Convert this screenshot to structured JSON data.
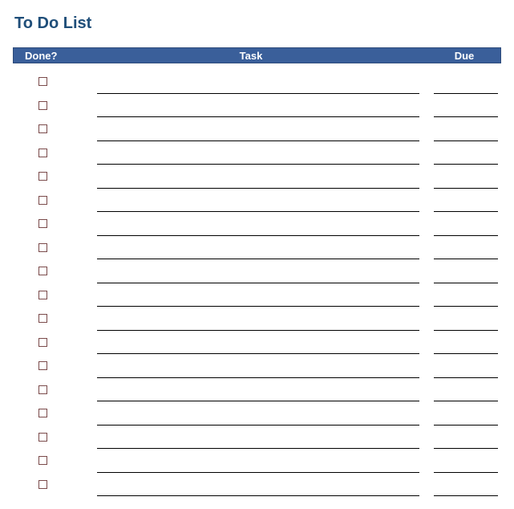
{
  "title": "To Do List",
  "columns": {
    "done": "Done?",
    "task": "Task",
    "due": "Due"
  },
  "rows": [
    {
      "done": false,
      "task": "",
      "due": ""
    },
    {
      "done": false,
      "task": "",
      "due": ""
    },
    {
      "done": false,
      "task": "",
      "due": ""
    },
    {
      "done": false,
      "task": "",
      "due": ""
    },
    {
      "done": false,
      "task": "",
      "due": ""
    },
    {
      "done": false,
      "task": "",
      "due": ""
    },
    {
      "done": false,
      "task": "",
      "due": ""
    },
    {
      "done": false,
      "task": "",
      "due": ""
    },
    {
      "done": false,
      "task": "",
      "due": ""
    },
    {
      "done": false,
      "task": "",
      "due": ""
    },
    {
      "done": false,
      "task": "",
      "due": ""
    },
    {
      "done": false,
      "task": "",
      "due": ""
    },
    {
      "done": false,
      "task": "",
      "due": ""
    },
    {
      "done": false,
      "task": "",
      "due": ""
    },
    {
      "done": false,
      "task": "",
      "due": ""
    },
    {
      "done": false,
      "task": "",
      "due": ""
    },
    {
      "done": false,
      "task": "",
      "due": ""
    },
    {
      "done": false,
      "task": "",
      "due": ""
    }
  ]
}
